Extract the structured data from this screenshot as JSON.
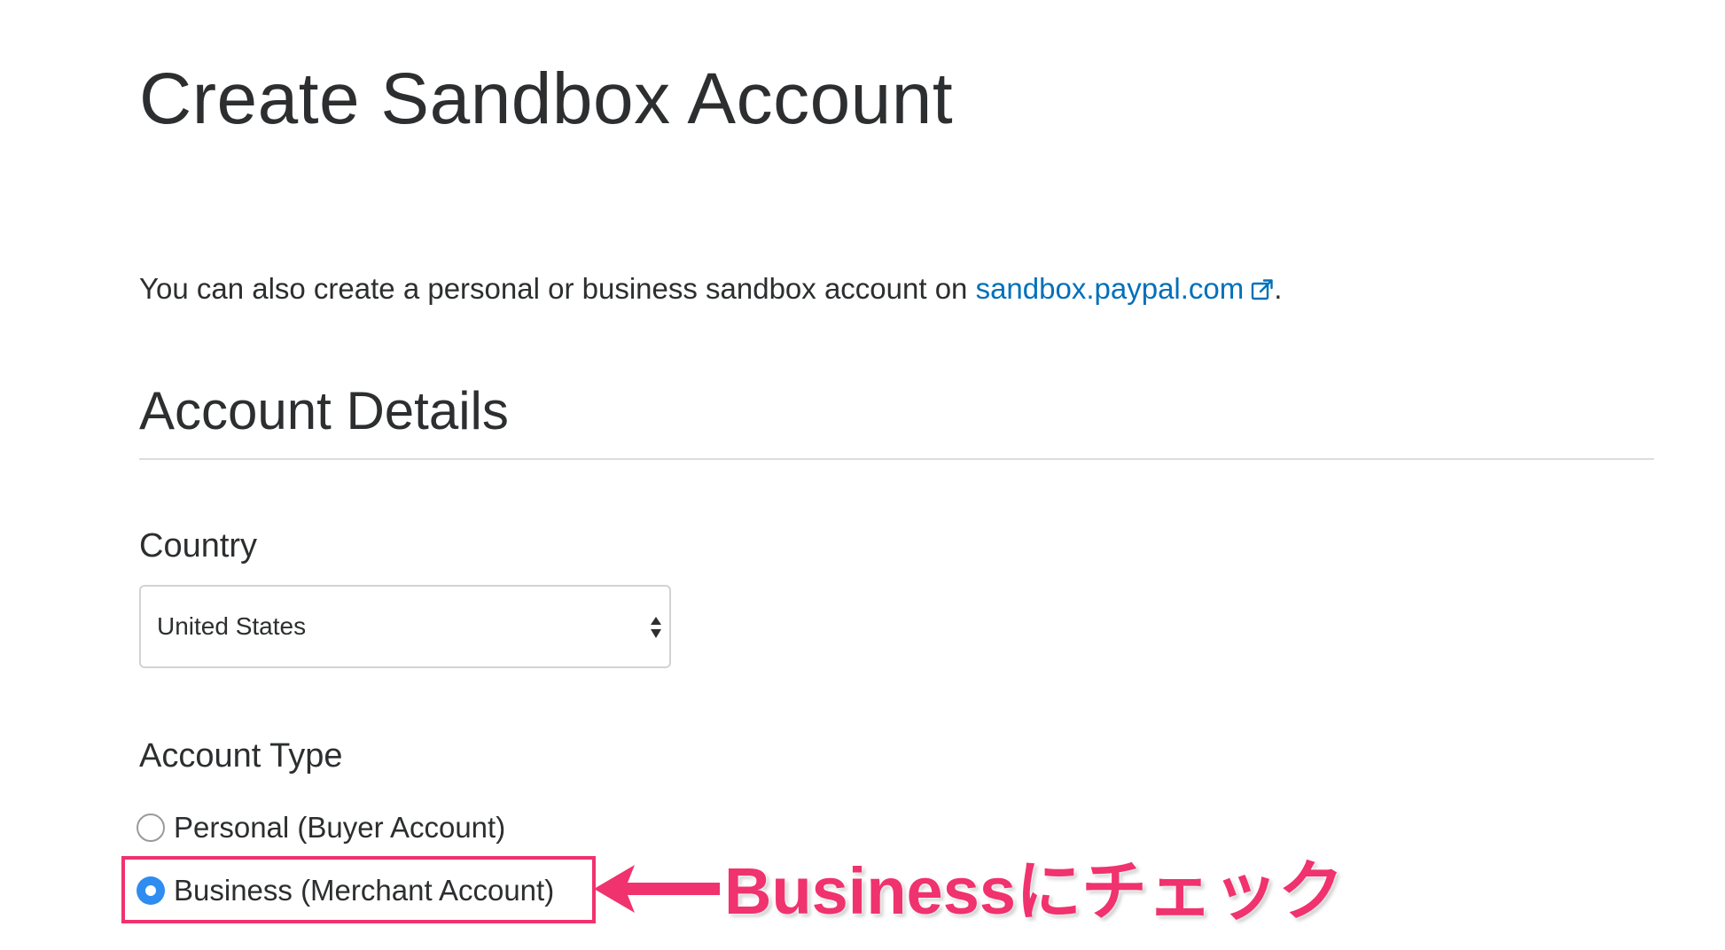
{
  "page": {
    "title": "Create Sandbox Account"
  },
  "intro": {
    "text": "You can also create a personal or business sandbox account on ",
    "link_text": "sandbox.paypal.com",
    "trailing": ".",
    "icon": "external-link-icon"
  },
  "account_details": {
    "section_title": "Account Details",
    "country": {
      "label": "Country",
      "selected_value": "United States"
    },
    "account_type": {
      "label": "Account Type",
      "options": [
        {
          "label": "Personal (Buyer Account)",
          "checked": false
        },
        {
          "label": "Business (Merchant Account)",
          "checked": true
        }
      ]
    }
  },
  "annotation": {
    "text": "Businessにチェック",
    "color": "#f0326e"
  },
  "colors": {
    "link": "#0070ba",
    "radio_checked": "#2f8cf0",
    "text": "#2c2e2f"
  }
}
